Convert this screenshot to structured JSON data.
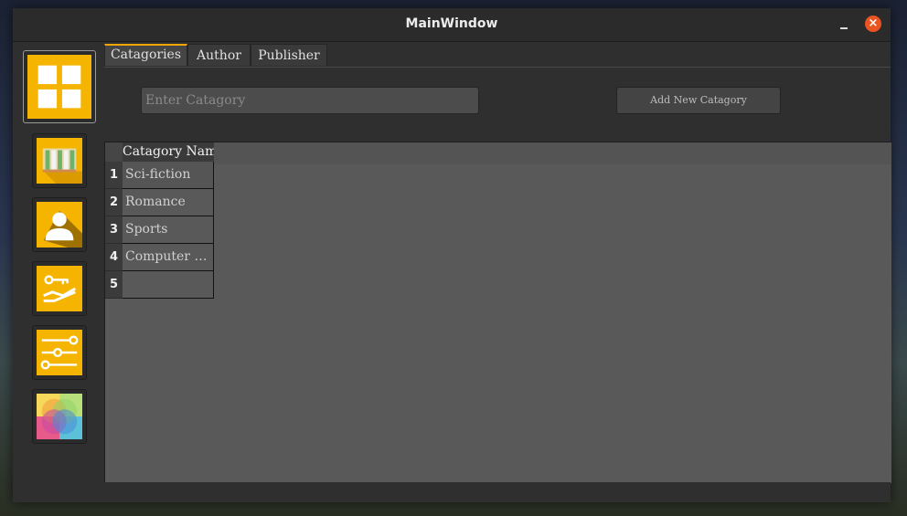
{
  "window": {
    "title": "MainWindow",
    "close_glyph": "×"
  },
  "sidebar": {
    "items": [
      {
        "id": "categories",
        "icon": "grid-icon",
        "active": true
      },
      {
        "id": "books",
        "icon": "books-icon",
        "active": false
      },
      {
        "id": "users",
        "icon": "user-icon",
        "active": false
      },
      {
        "id": "login",
        "icon": "key-hand-icon",
        "active": false
      },
      {
        "id": "settings",
        "icon": "sliders-icon",
        "active": false
      },
      {
        "id": "themes",
        "icon": "color-wheel-icon",
        "active": false
      }
    ]
  },
  "tabs": [
    {
      "label": "Catagories",
      "active": true
    },
    {
      "label": "Author",
      "active": false
    },
    {
      "label": "Publisher",
      "active": false
    }
  ],
  "form": {
    "category_placeholder": "Enter Catagory",
    "category_value": "",
    "add_button_label": "Add New Catagory"
  },
  "table": {
    "column_header": "Catagory Name",
    "rows": [
      {
        "num": "1",
        "name": "Sci-fiction"
      },
      {
        "num": "2",
        "name": "Romance"
      },
      {
        "num": "3",
        "name": "Sports"
      },
      {
        "num": "4",
        "name": "Computer …"
      },
      {
        "num": "5",
        "name": ""
      }
    ]
  },
  "colors": {
    "accent": "#f4b400",
    "tab_accent": "#f0a600",
    "close": "#e95420"
  }
}
